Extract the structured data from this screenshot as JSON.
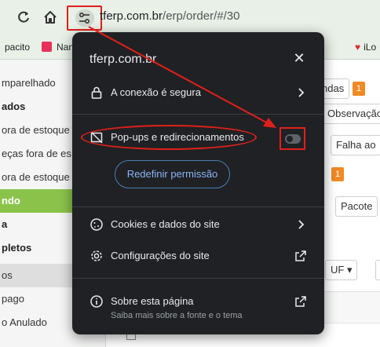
{
  "browser": {
    "url_host": "tferp.com.br",
    "url_path": "/erp/order/#/30",
    "reload_icon": "reload-icon",
    "home_icon": "home-icon",
    "site_controls_icon": "tune-icon"
  },
  "bookmarks": [
    {
      "label": "pacito",
      "icon_color": "#e8f0e8"
    },
    {
      "label": "Nan",
      "icon_color": "#e8305a"
    },
    {
      "label": "iLo",
      "icon_color": "#d32f2f"
    }
  ],
  "sidebar": {
    "items": [
      {
        "label": "mparelhado",
        "style": "normal"
      },
      {
        "label": "ados",
        "style": "bold"
      },
      {
        "label": "ora de estoque",
        "style": "normal"
      },
      {
        "label": "eças fora de es",
        "style": "normal"
      },
      {
        "label": "ora de estoque",
        "style": "normal"
      },
      {
        "label": "ndo",
        "style": "green"
      },
      {
        "label": "a",
        "style": "bold"
      },
      {
        "label": "pletos",
        "style": "bold"
      },
      {
        "label": "os",
        "style": "grey"
      },
      {
        "label": "pago",
        "style": "normal"
      },
      {
        "label": "o Anulado",
        "style": "normal"
      }
    ]
  },
  "content": {
    "chips": {
      "vendas": "ndas",
      "vendas_badge": "1",
      "observacao": "Observação",
      "falha": "Falha ao",
      "badge2": "1",
      "pacote": "Pacote",
      "uf": "UF ▾"
    }
  },
  "popup": {
    "title": "tferp.com.br",
    "close_icon": "close-icon",
    "rows": {
      "connection": "A conexão é segura",
      "popups": "Pop-ups e redirecionamentos",
      "cookies": "Cookies e dados do site",
      "settings": "Configurações do site",
      "about": "Sobre esta página",
      "about_sub": "Saiba mais sobre a fonte e o tema"
    },
    "reset_button": "Redefinir permissão",
    "popups_toggle_on": false
  },
  "colors": {
    "popup_bg": "#202124",
    "annotation_red": "#e0201a",
    "sidebar_active": "#8bc34a",
    "badge_orange": "#f08a24",
    "link_blue": "#8ab4f8"
  }
}
